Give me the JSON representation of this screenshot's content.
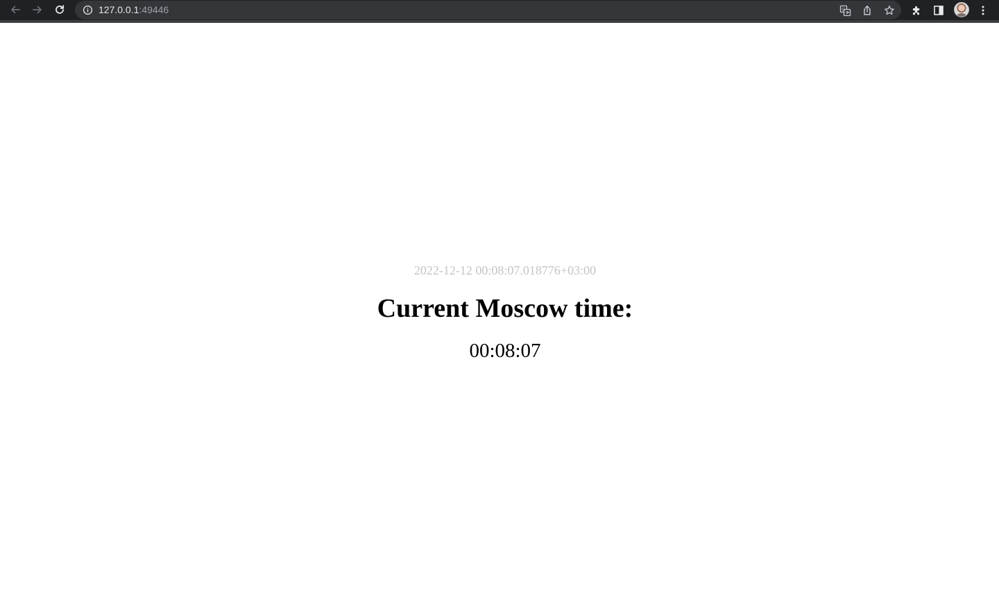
{
  "browser": {
    "url_host": "127.0.0.1",
    "url_port": ":49446",
    "icons": {
      "back": "arrow-left-icon",
      "forward": "arrow-right-icon",
      "reload": "reload-icon",
      "site_info": "info-circle-icon",
      "translate": "translate-icon",
      "share": "share-icon",
      "bookmark": "star-icon",
      "extensions": "puzzle-icon",
      "side_panel": "side-panel-icon",
      "profile": "avatar",
      "menu": "kebab-menu-icon"
    },
    "colors": {
      "toolbar_bg": "#202124",
      "omnibox_bg": "#35363a",
      "url_text": "#e8eaed",
      "url_port_text": "#9aa0a6"
    }
  },
  "page": {
    "timestamp": "2022-12-12 00:08:07.018776+03:00",
    "heading": "Current Moscow time:",
    "clock": "00:08:07",
    "colors": {
      "background": "#ffffff",
      "timestamp_text": "#c4c4c4",
      "heading_text": "#000000"
    }
  }
}
